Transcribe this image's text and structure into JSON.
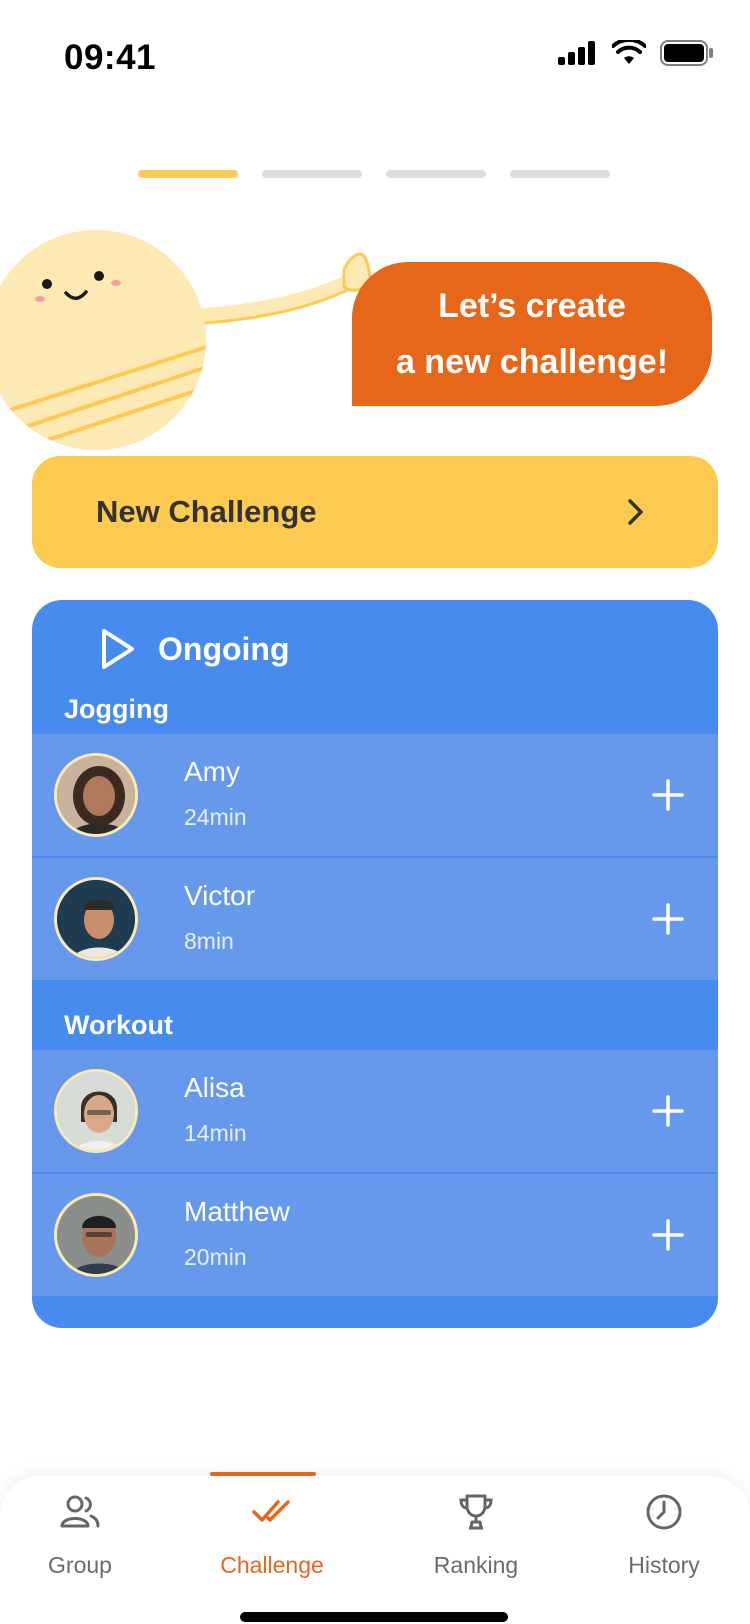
{
  "status_bar": {
    "time": "09:41"
  },
  "pager": {
    "segments": 4,
    "active_index": 0
  },
  "bubble": {
    "line1": "Let’s create",
    "line2": "a new challenge!"
  },
  "new_challenge": {
    "label": "New Challenge"
  },
  "ongoing": {
    "title": "Ongoing",
    "groups": [
      {
        "label": "Jogging",
        "entries": [
          {
            "name": "Amy",
            "time": "24min"
          },
          {
            "name": "Victor",
            "time": "8min"
          }
        ]
      },
      {
        "label": "Workout",
        "entries": [
          {
            "name": "Alisa",
            "time": "14min"
          },
          {
            "name": "Matthew",
            "time": "20min"
          }
        ]
      }
    ]
  },
  "tabs": [
    {
      "label": "Group",
      "icon": "users-icon"
    },
    {
      "label": "Challenge",
      "icon": "double-check-icon",
      "active": true
    },
    {
      "label": "Ranking",
      "icon": "trophy-icon"
    },
    {
      "label": "History",
      "icon": "clock-icon"
    }
  ],
  "colors": {
    "accent": "#e6661a",
    "yellow": "#fdcb52",
    "card_blue": "#478bee",
    "row_blue": "#6699eb"
  }
}
